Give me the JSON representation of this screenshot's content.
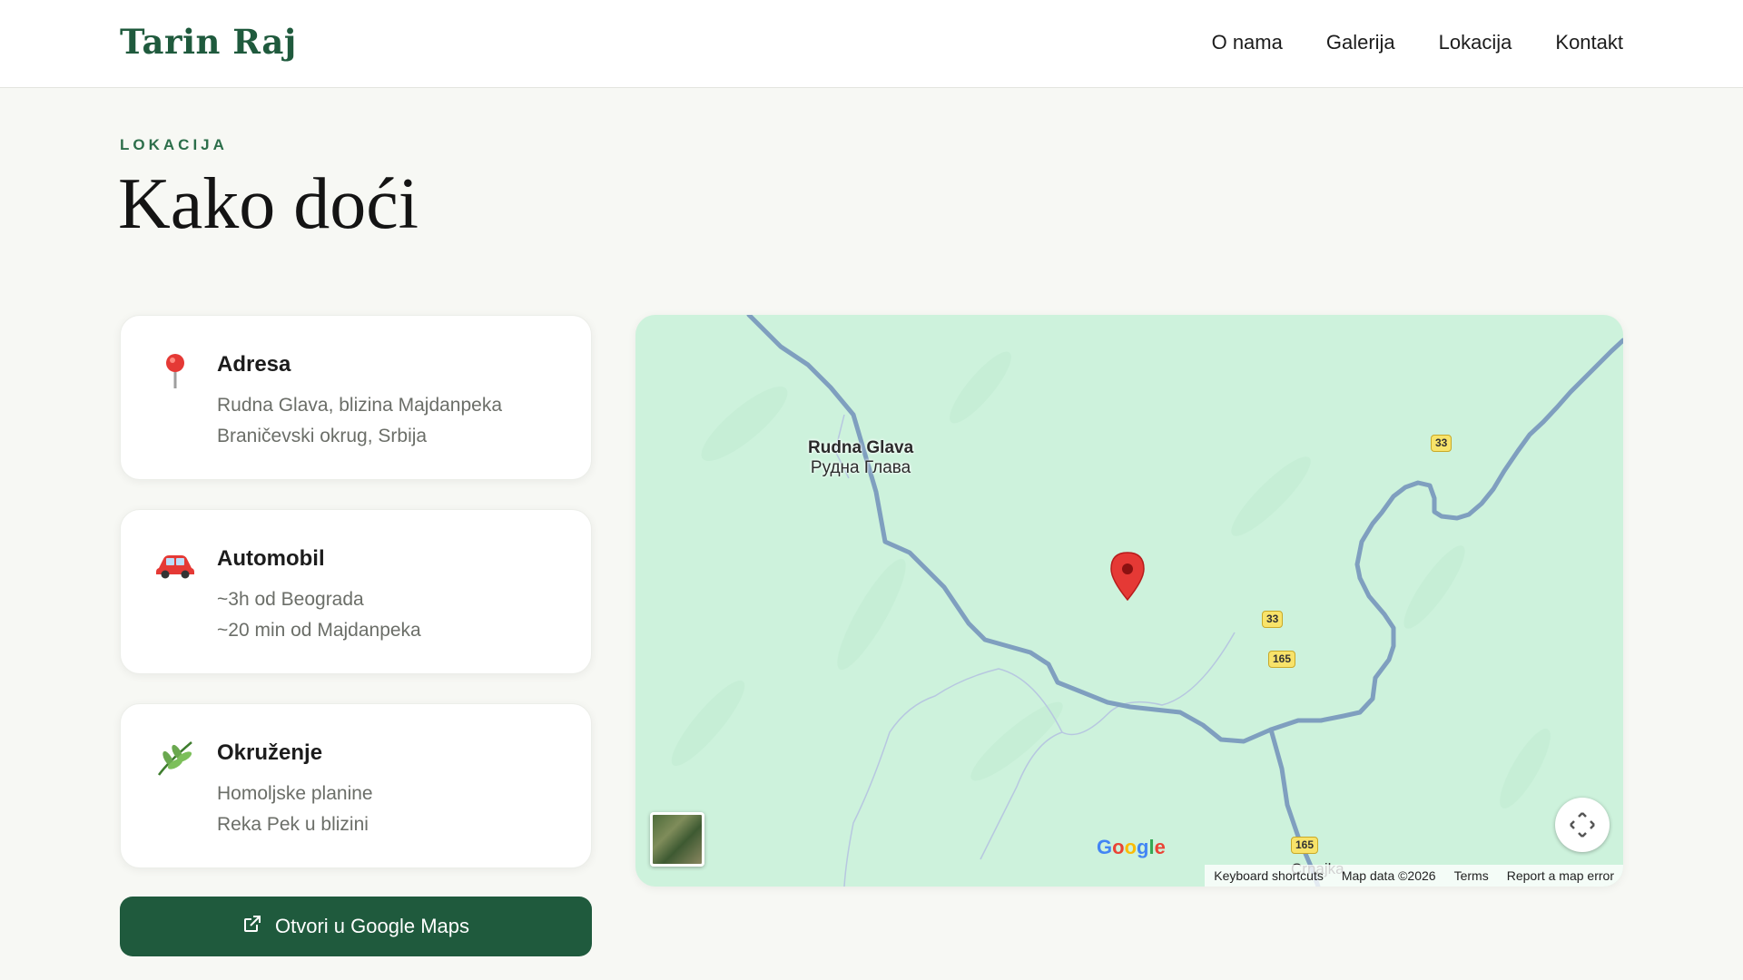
{
  "header": {
    "brand": "Tarin Raj",
    "nav": [
      "O nama",
      "Galerija",
      "Lokacija",
      "Kontakt"
    ]
  },
  "section": {
    "eyebrow": "LOKACIJA",
    "title": "Kako doći"
  },
  "cards": [
    {
      "icon": "map-pin-icon",
      "title": "Adresa",
      "lines": [
        "Rudna Glava, blizina Majdanpeka",
        "Braničevski okrug, Srbija"
      ]
    },
    {
      "icon": "car-icon",
      "title": "Automobil",
      "lines": [
        "~3h od Beograda",
        "~20 min od Majdanpeka"
      ]
    },
    {
      "icon": "leaf-icon",
      "title": "Okruženje",
      "lines": [
        "Homoljske planine",
        "Reka Pek u blizini"
      ]
    }
  ],
  "button": {
    "label": "Otvori u Google Maps",
    "icon": "external-link-icon"
  },
  "map": {
    "place_name": "Rudna Glava",
    "place_name_cyrillic": "Рудна Глава",
    "road_shields": [
      "33",
      "33",
      "165",
      "165"
    ],
    "bottom_town": "Crnajka",
    "logo": "Google",
    "attribution": [
      "Keyboard shortcuts",
      "Map data ©2026",
      "Terms",
      "Report a map error"
    ]
  },
  "colors": {
    "brand": "#1f5a3d",
    "map_bg": "#cdf2dc",
    "road": "#7f9fbf"
  }
}
